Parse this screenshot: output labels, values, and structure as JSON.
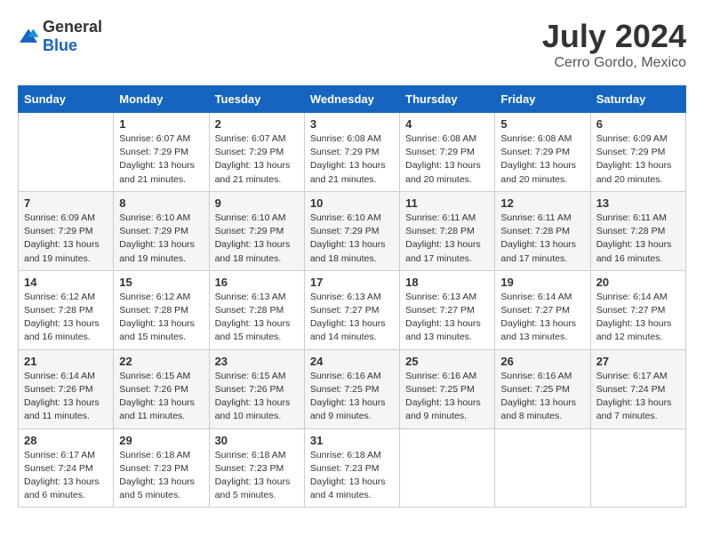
{
  "header": {
    "logo_general": "General",
    "logo_blue": "Blue",
    "month": "July 2024",
    "location": "Cerro Gordo, Mexico"
  },
  "days_of_week": [
    "Sunday",
    "Monday",
    "Tuesday",
    "Wednesday",
    "Thursday",
    "Friday",
    "Saturday"
  ],
  "weeks": [
    [
      {
        "day": "",
        "info": ""
      },
      {
        "day": "1",
        "info": "Sunrise: 6:07 AM\nSunset: 7:29 PM\nDaylight: 13 hours and 21 minutes."
      },
      {
        "day": "2",
        "info": "Sunrise: 6:07 AM\nSunset: 7:29 PM\nDaylight: 13 hours and 21 minutes."
      },
      {
        "day": "3",
        "info": "Sunrise: 6:08 AM\nSunset: 7:29 PM\nDaylight: 13 hours and 21 minutes."
      },
      {
        "day": "4",
        "info": "Sunrise: 6:08 AM\nSunset: 7:29 PM\nDaylight: 13 hours and 20 minutes."
      },
      {
        "day": "5",
        "info": "Sunrise: 6:08 AM\nSunset: 7:29 PM\nDaylight: 13 hours and 20 minutes."
      },
      {
        "day": "6",
        "info": "Sunrise: 6:09 AM\nSunset: 7:29 PM\nDaylight: 13 hours and 20 minutes."
      }
    ],
    [
      {
        "day": "7",
        "info": "Sunrise: 6:09 AM\nSunset: 7:29 PM\nDaylight: 13 hours and 19 minutes."
      },
      {
        "day": "8",
        "info": "Sunrise: 6:10 AM\nSunset: 7:29 PM\nDaylight: 13 hours and 19 minutes."
      },
      {
        "day": "9",
        "info": "Sunrise: 6:10 AM\nSunset: 7:29 PM\nDaylight: 13 hours and 18 minutes."
      },
      {
        "day": "10",
        "info": "Sunrise: 6:10 AM\nSunset: 7:29 PM\nDaylight: 13 hours and 18 minutes."
      },
      {
        "day": "11",
        "info": "Sunrise: 6:11 AM\nSunset: 7:28 PM\nDaylight: 13 hours and 17 minutes."
      },
      {
        "day": "12",
        "info": "Sunrise: 6:11 AM\nSunset: 7:28 PM\nDaylight: 13 hours and 17 minutes."
      },
      {
        "day": "13",
        "info": "Sunrise: 6:11 AM\nSunset: 7:28 PM\nDaylight: 13 hours and 16 minutes."
      }
    ],
    [
      {
        "day": "14",
        "info": "Sunrise: 6:12 AM\nSunset: 7:28 PM\nDaylight: 13 hours and 16 minutes."
      },
      {
        "day": "15",
        "info": "Sunrise: 6:12 AM\nSunset: 7:28 PM\nDaylight: 13 hours and 15 minutes."
      },
      {
        "day": "16",
        "info": "Sunrise: 6:13 AM\nSunset: 7:28 PM\nDaylight: 13 hours and 15 minutes."
      },
      {
        "day": "17",
        "info": "Sunrise: 6:13 AM\nSunset: 7:27 PM\nDaylight: 13 hours and 14 minutes."
      },
      {
        "day": "18",
        "info": "Sunrise: 6:13 AM\nSunset: 7:27 PM\nDaylight: 13 hours and 13 minutes."
      },
      {
        "day": "19",
        "info": "Sunrise: 6:14 AM\nSunset: 7:27 PM\nDaylight: 13 hours and 13 minutes."
      },
      {
        "day": "20",
        "info": "Sunrise: 6:14 AM\nSunset: 7:27 PM\nDaylight: 13 hours and 12 minutes."
      }
    ],
    [
      {
        "day": "21",
        "info": "Sunrise: 6:14 AM\nSunset: 7:26 PM\nDaylight: 13 hours and 11 minutes."
      },
      {
        "day": "22",
        "info": "Sunrise: 6:15 AM\nSunset: 7:26 PM\nDaylight: 13 hours and 11 minutes."
      },
      {
        "day": "23",
        "info": "Sunrise: 6:15 AM\nSunset: 7:26 PM\nDaylight: 13 hours and 10 minutes."
      },
      {
        "day": "24",
        "info": "Sunrise: 6:16 AM\nSunset: 7:25 PM\nDaylight: 13 hours and 9 minutes."
      },
      {
        "day": "25",
        "info": "Sunrise: 6:16 AM\nSunset: 7:25 PM\nDaylight: 13 hours and 9 minutes."
      },
      {
        "day": "26",
        "info": "Sunrise: 6:16 AM\nSunset: 7:25 PM\nDaylight: 13 hours and 8 minutes."
      },
      {
        "day": "27",
        "info": "Sunrise: 6:17 AM\nSunset: 7:24 PM\nDaylight: 13 hours and 7 minutes."
      }
    ],
    [
      {
        "day": "28",
        "info": "Sunrise: 6:17 AM\nSunset: 7:24 PM\nDaylight: 13 hours and 6 minutes."
      },
      {
        "day": "29",
        "info": "Sunrise: 6:18 AM\nSunset: 7:23 PM\nDaylight: 13 hours and 5 minutes."
      },
      {
        "day": "30",
        "info": "Sunrise: 6:18 AM\nSunset: 7:23 PM\nDaylight: 13 hours and 5 minutes."
      },
      {
        "day": "31",
        "info": "Sunrise: 6:18 AM\nSunset: 7:23 PM\nDaylight: 13 hours and 4 minutes."
      },
      {
        "day": "",
        "info": ""
      },
      {
        "day": "",
        "info": ""
      },
      {
        "day": "",
        "info": ""
      }
    ]
  ]
}
